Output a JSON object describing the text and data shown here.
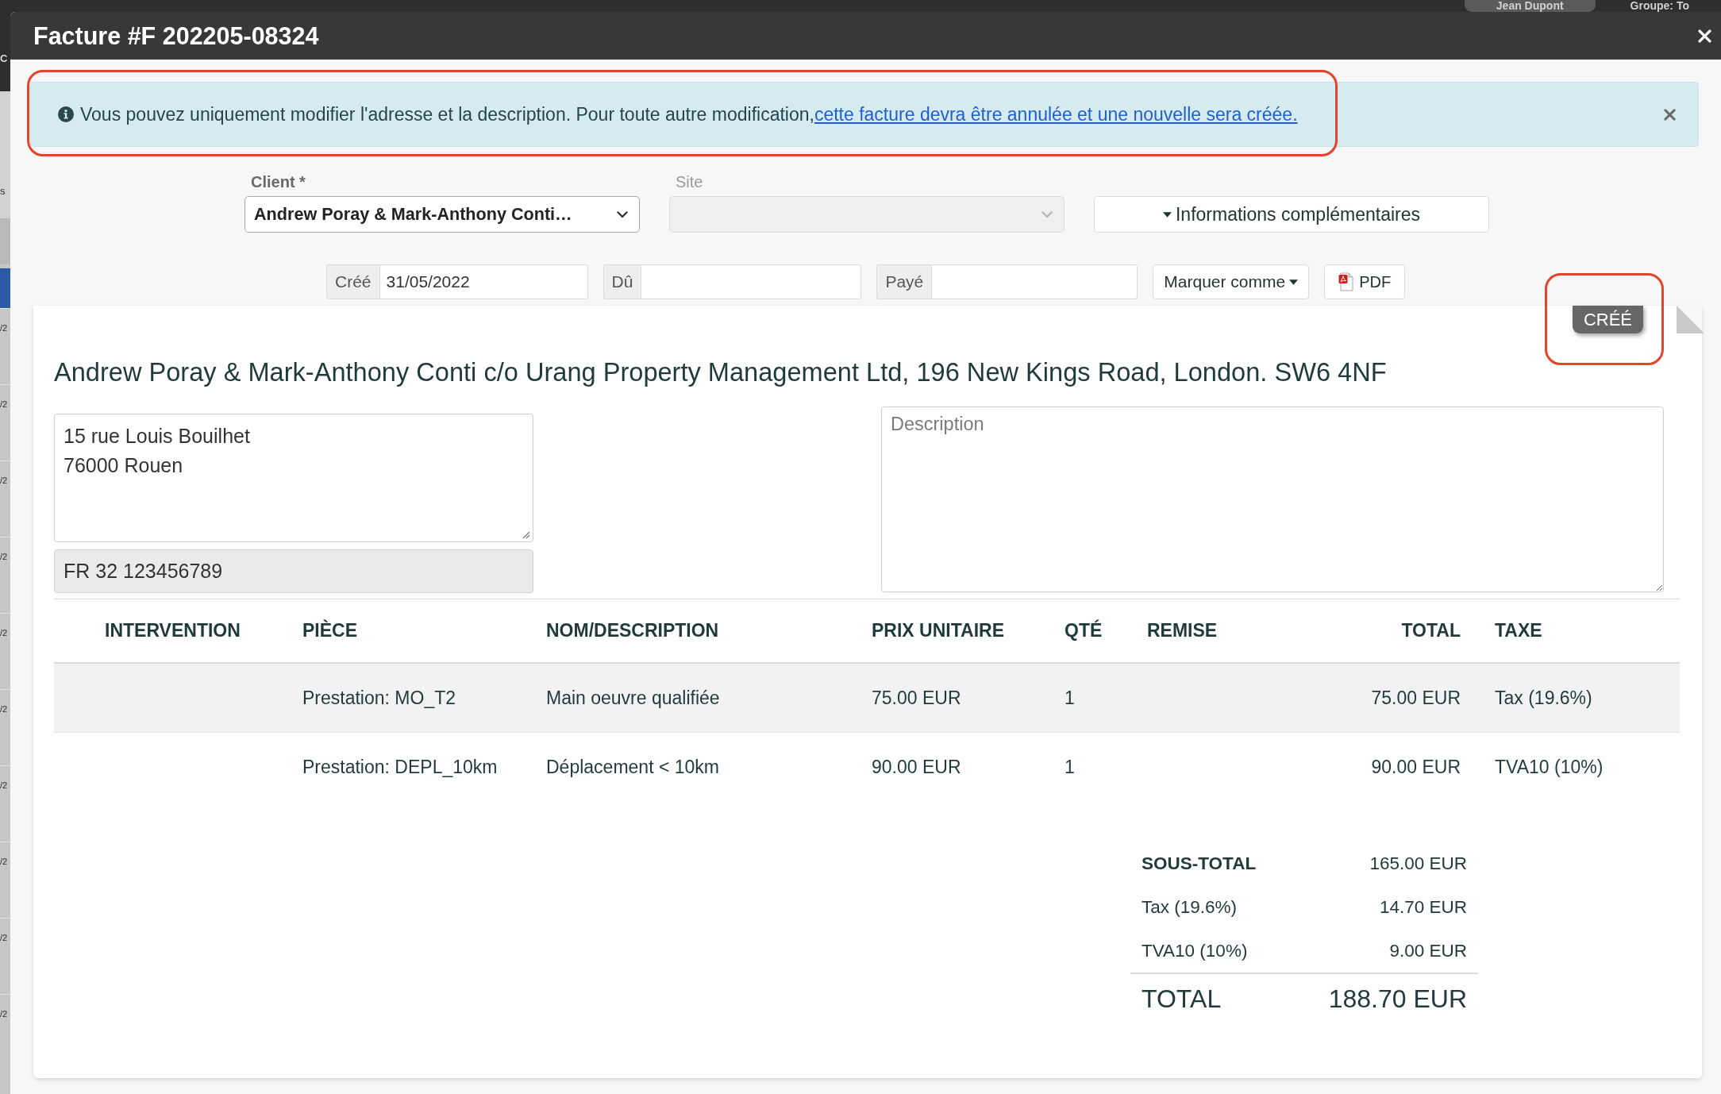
{
  "background": {
    "navbar": {
      "brand": "C",
      "user": "Jean Dupont",
      "group": "Groupe: To"
    },
    "list": {
      "header": "s",
      "rows": [
        {
          "selected": true
        },
        {
          "text": "/2",
          "selected": false
        },
        {
          "text": "/2",
          "selected": false
        },
        {
          "text": "/2",
          "selected": false
        },
        {
          "text": "/2",
          "selected": false
        },
        {
          "text": "/2",
          "selected": false
        },
        {
          "text": "/2",
          "selected": false
        },
        {
          "text": "/2",
          "selected": false
        },
        {
          "text": "/2",
          "selected": false
        },
        {
          "text": "/2",
          "selected": false
        },
        {
          "text": "/2",
          "selected": false
        }
      ]
    }
  },
  "modal": {
    "title": "Facture #F 202205-08324"
  },
  "alert": {
    "message": "Vous pouvez uniquement modifier l'adresse et la description. Pour toute autre modification,",
    "link": "cette facture devra être annulée et une nouvelle sera créée.",
    "highlighted": true
  },
  "form": {
    "client": {
      "label": "Client *",
      "value": "Andrew Poray & Mark-Anthony Conti…"
    },
    "site": {
      "label": "Site",
      "disabled": true
    },
    "more_info_button": "Informations complémentaires",
    "dates": [
      {
        "label": "Créé",
        "value": "31/05/2022"
      },
      {
        "label": "Dû"
      },
      {
        "label": "Payé"
      }
    ],
    "mark_as_button": "Marquer comme",
    "pdf_button": "PDF"
  },
  "document": {
    "status": {
      "label": "CRÉÉ",
      "highlighted": true
    },
    "recipient": "Andrew Poray & Mark-Anthony Conti c/o Urang Property Management Ltd, 196 New Kings Road, London. SW6 4NF",
    "address": "15 rue Louis Bouilhet\n76000 Rouen",
    "vat_number": "FR 32 123456789",
    "description": {
      "placeholder": "Description"
    },
    "table": {
      "columns": [
        "INTERVENTION",
        "PIÈCE",
        "NOM/DESCRIPTION",
        "PRIX UNITAIRE",
        "QTÉ",
        "REMISE",
        "TOTAL",
        "TAXE"
      ],
      "rows": [
        {
          "piece": "Prestation: MO_T2",
          "description": "Main oeuvre qualifiée",
          "unit_price": "75.00 EUR",
          "quantity": "1",
          "total": "75.00 EUR",
          "tax": "Tax (19.6%)"
        },
        {
          "piece": "Prestation: DEPL_10km",
          "description": "Déplacement < 10km",
          "unit_price": "90.00 EUR",
          "quantity": "1",
          "total": "90.00 EUR",
          "tax": "TVA10 (10%)"
        }
      ]
    },
    "totals": [
      {
        "kind": "subtotal",
        "label": "SOUS-TOTAL",
        "amount": "165.00 EUR"
      },
      {
        "kind": "tax",
        "label": "Tax (19.6%)",
        "amount": "14.70 EUR"
      },
      {
        "kind": "tax",
        "label": "TVA10 (10%)",
        "amount": "9.00 EUR"
      },
      {
        "kind": "grand_total",
        "label": "TOTAL",
        "amount": "188.70 EUR"
      }
    ]
  }
}
